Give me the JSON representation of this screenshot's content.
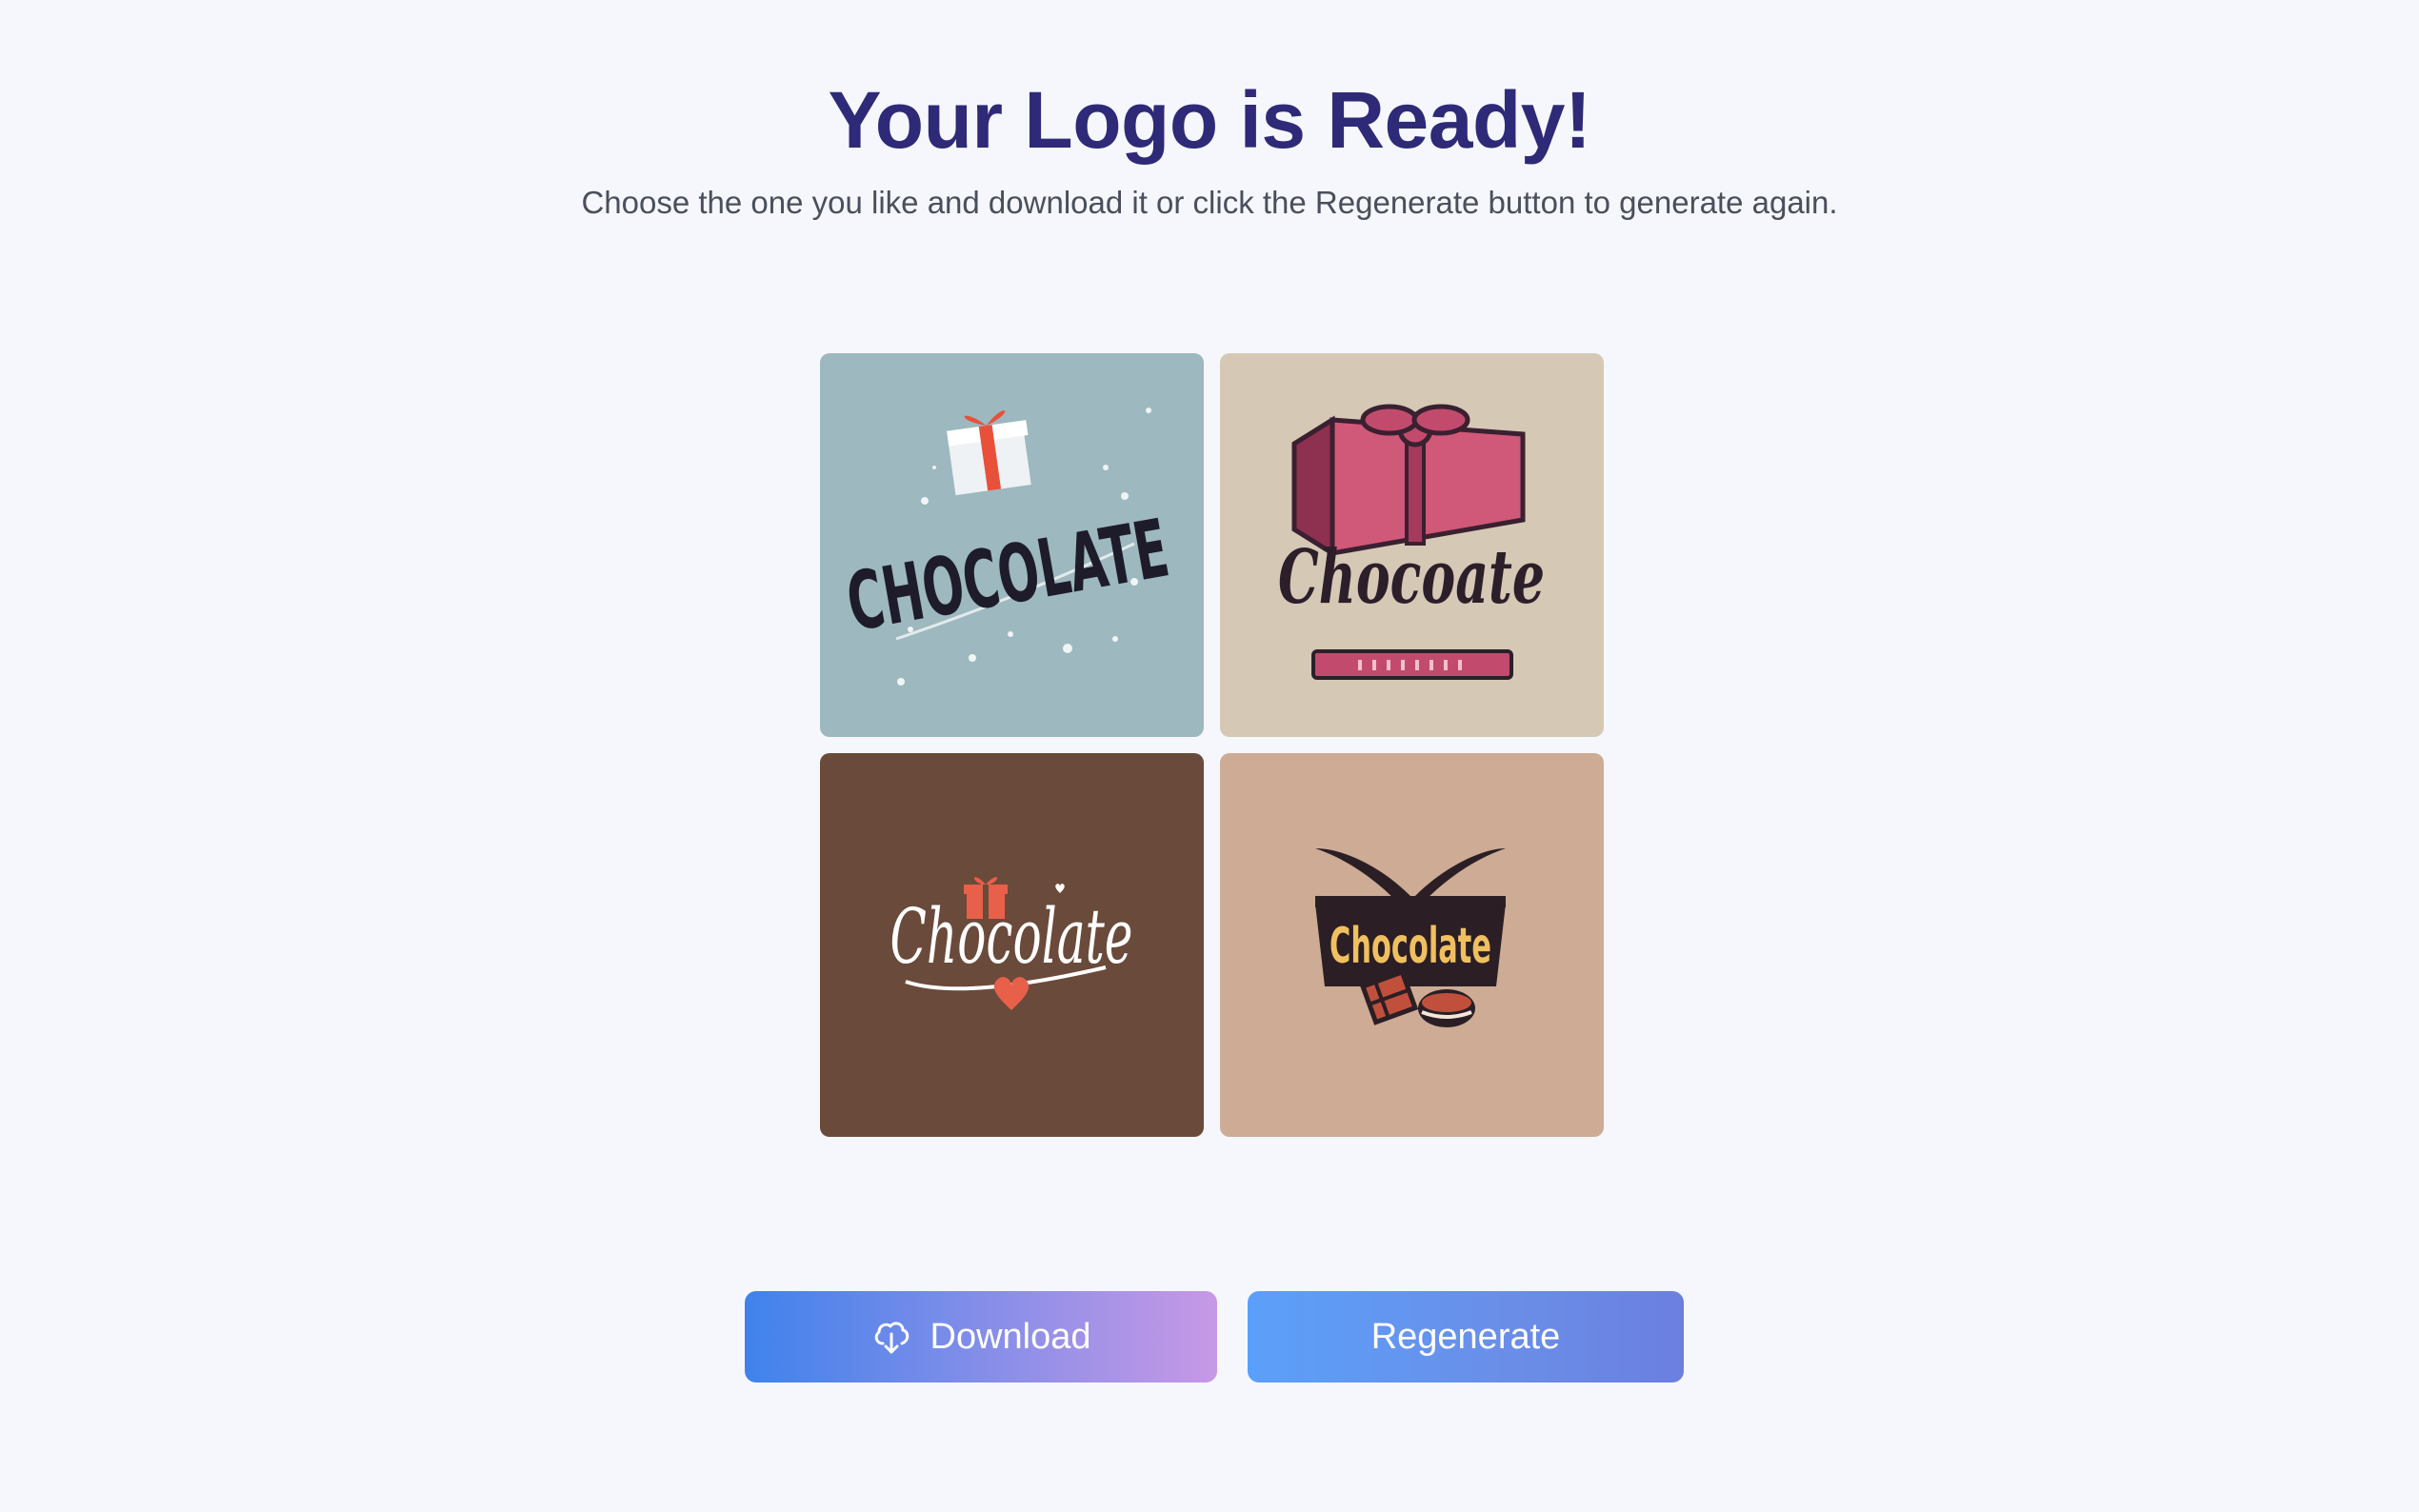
{
  "header": {
    "title": "Your Logo is Ready!",
    "subtitle": "Choose the one you like and download it or click the Regenerate button to generate again."
  },
  "logos": [
    {
      "text": "CHOCOLATE",
      "background": "#9db8bf",
      "icon": "gift-box-icon"
    },
    {
      "text": "Chocoate",
      "background": "#d5c8b5",
      "icon": "gift-box-icon"
    },
    {
      "text": "Chocolate",
      "background": "#6a4a3b",
      "icon": "heart-icon"
    },
    {
      "text": "Chocolate",
      "background": "#cdab95",
      "icon": "chocolate-bar-icon"
    }
  ],
  "actions": {
    "download_label": "Download",
    "download_icon": "cloud-download-icon",
    "regenerate_label": "Regenerate"
  },
  "colors": {
    "title": "#2e2a78",
    "page_background": "#f6f7fd",
    "download_gradient_start": "#3f82ec",
    "download_gradient_end": "#c898e6",
    "regenerate_gradient_start": "#5aa0fa",
    "regenerate_gradient_end": "#6b7fe0"
  }
}
